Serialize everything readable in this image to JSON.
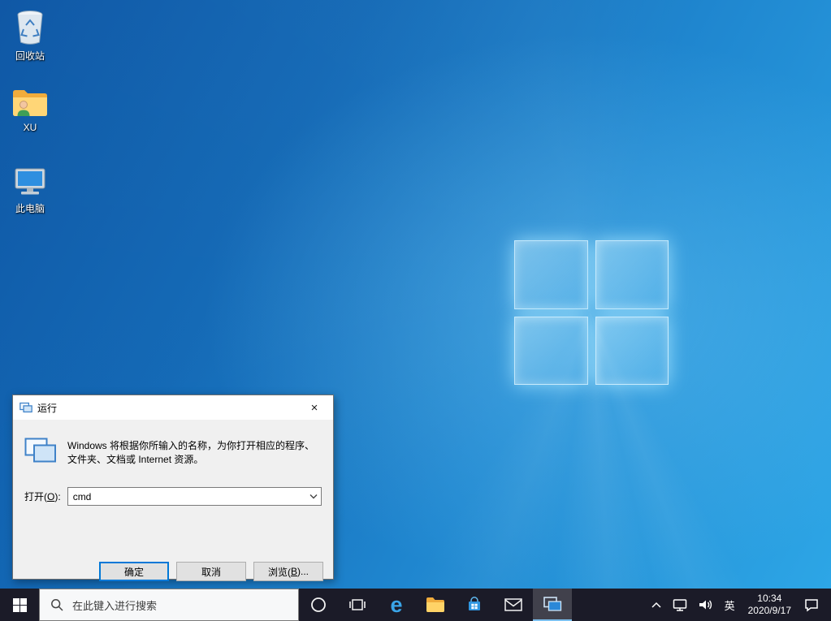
{
  "desktop": {
    "icons": [
      {
        "label": "回收站"
      },
      {
        "label": "XU"
      },
      {
        "label": "此电脑"
      }
    ]
  },
  "run_dialog": {
    "title": "运行",
    "close_glyph": "×",
    "description_line1": "Windows 将根据你所输入的名称，为你打开相应的程序、",
    "description_line2": "文件夹、文档或 Internet 资源。",
    "open_label_pre": "打开(",
    "open_label_mnemonic": "O",
    "open_label_post": "):",
    "input_value": "cmd",
    "ok_label": "确定",
    "cancel_label": "取消",
    "browse_pre": "浏览(",
    "browse_mnemonic": "B",
    "browse_post": ")..."
  },
  "taskbar": {
    "search_placeholder": "在此键入进行搜索",
    "edge_glyph": "e",
    "tray": {
      "language": "英",
      "time": "10:34",
      "date": "2020/9/17"
    }
  },
  "colors": {
    "accent": "#0078d7",
    "taskbar_bg": "#1b1b28",
    "wallpaper_dark": "#0b55a4",
    "wallpaper_light": "#2da6e6",
    "folder_yellow": "#ffd677"
  }
}
